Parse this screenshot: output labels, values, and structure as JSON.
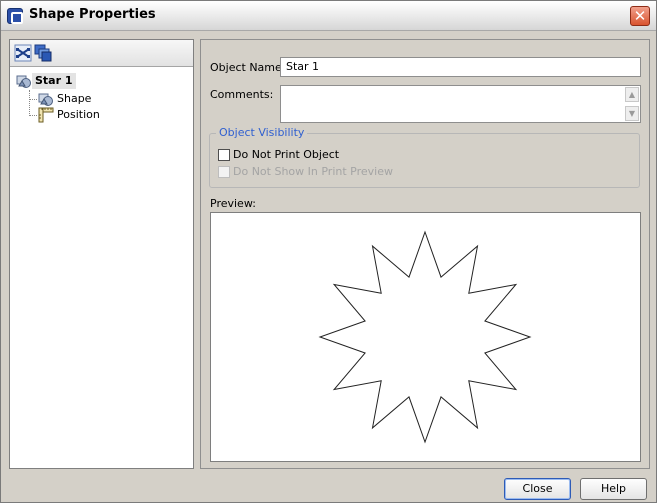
{
  "window": {
    "title": "Shape Properties",
    "close_glyph": "✕"
  },
  "tree": {
    "toolbar": [
      "expand-collapse-icon",
      "layers-icon"
    ],
    "root": {
      "label": "Star 1",
      "icon": "shape-node-icon"
    },
    "children": [
      {
        "label": "Shape",
        "icon": "shape-node-icon"
      },
      {
        "label": "Position",
        "icon": "position-ruler-icon"
      }
    ]
  },
  "form": {
    "object_name_label": "Object Name:",
    "object_name_value": "Star 1",
    "comments_label": "Comments:",
    "comments_value": "",
    "visibility_group_title": "Object Visibility",
    "do_not_print_label": "Do Not Print Object",
    "do_not_print_checked": false,
    "do_not_show_preview_label": "Do Not Show In Print Preview",
    "do_not_show_preview_checked": false,
    "preview_label": "Preview:"
  },
  "preview": {
    "shape": "12-point star"
  },
  "buttons": {
    "close": "Close",
    "help": "Help"
  },
  "colors": {
    "group_title": "#2f5fd0",
    "close_button_bg": "#d9542f"
  }
}
